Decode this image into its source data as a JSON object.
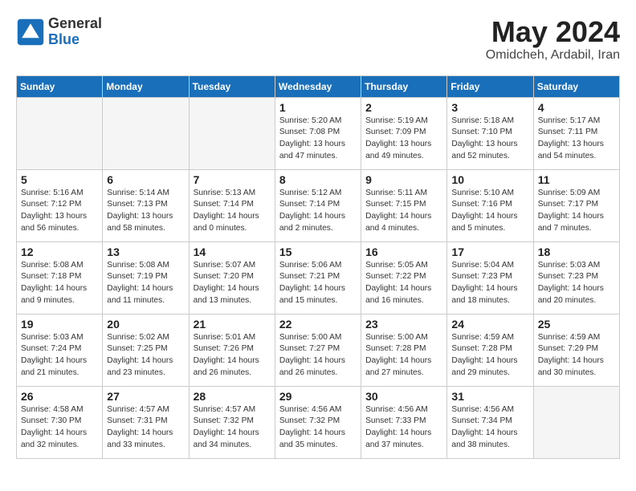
{
  "header": {
    "logo_general": "General",
    "logo_blue": "Blue",
    "month": "May 2024",
    "location": "Omidcheh, Ardabil, Iran"
  },
  "weekdays": [
    "Sunday",
    "Monday",
    "Tuesday",
    "Wednesday",
    "Thursday",
    "Friday",
    "Saturday"
  ],
  "weeks": [
    [
      {
        "day": "",
        "info": ""
      },
      {
        "day": "",
        "info": ""
      },
      {
        "day": "",
        "info": ""
      },
      {
        "day": "1",
        "info": "Sunrise: 5:20 AM\nSunset: 7:08 PM\nDaylight: 13 hours\nand 47 minutes."
      },
      {
        "day": "2",
        "info": "Sunrise: 5:19 AM\nSunset: 7:09 PM\nDaylight: 13 hours\nand 49 minutes."
      },
      {
        "day": "3",
        "info": "Sunrise: 5:18 AM\nSunset: 7:10 PM\nDaylight: 13 hours\nand 52 minutes."
      },
      {
        "day": "4",
        "info": "Sunrise: 5:17 AM\nSunset: 7:11 PM\nDaylight: 13 hours\nand 54 minutes."
      }
    ],
    [
      {
        "day": "5",
        "info": "Sunrise: 5:16 AM\nSunset: 7:12 PM\nDaylight: 13 hours\nand 56 minutes."
      },
      {
        "day": "6",
        "info": "Sunrise: 5:14 AM\nSunset: 7:13 PM\nDaylight: 13 hours\nand 58 minutes."
      },
      {
        "day": "7",
        "info": "Sunrise: 5:13 AM\nSunset: 7:14 PM\nDaylight: 14 hours\nand 0 minutes."
      },
      {
        "day": "8",
        "info": "Sunrise: 5:12 AM\nSunset: 7:14 PM\nDaylight: 14 hours\nand 2 minutes."
      },
      {
        "day": "9",
        "info": "Sunrise: 5:11 AM\nSunset: 7:15 PM\nDaylight: 14 hours\nand 4 minutes."
      },
      {
        "day": "10",
        "info": "Sunrise: 5:10 AM\nSunset: 7:16 PM\nDaylight: 14 hours\nand 5 minutes."
      },
      {
        "day": "11",
        "info": "Sunrise: 5:09 AM\nSunset: 7:17 PM\nDaylight: 14 hours\nand 7 minutes."
      }
    ],
    [
      {
        "day": "12",
        "info": "Sunrise: 5:08 AM\nSunset: 7:18 PM\nDaylight: 14 hours\nand 9 minutes."
      },
      {
        "day": "13",
        "info": "Sunrise: 5:08 AM\nSunset: 7:19 PM\nDaylight: 14 hours\nand 11 minutes."
      },
      {
        "day": "14",
        "info": "Sunrise: 5:07 AM\nSunset: 7:20 PM\nDaylight: 14 hours\nand 13 minutes."
      },
      {
        "day": "15",
        "info": "Sunrise: 5:06 AM\nSunset: 7:21 PM\nDaylight: 14 hours\nand 15 minutes."
      },
      {
        "day": "16",
        "info": "Sunrise: 5:05 AM\nSunset: 7:22 PM\nDaylight: 14 hours\nand 16 minutes."
      },
      {
        "day": "17",
        "info": "Sunrise: 5:04 AM\nSunset: 7:23 PM\nDaylight: 14 hours\nand 18 minutes."
      },
      {
        "day": "18",
        "info": "Sunrise: 5:03 AM\nSunset: 7:23 PM\nDaylight: 14 hours\nand 20 minutes."
      }
    ],
    [
      {
        "day": "19",
        "info": "Sunrise: 5:03 AM\nSunset: 7:24 PM\nDaylight: 14 hours\nand 21 minutes."
      },
      {
        "day": "20",
        "info": "Sunrise: 5:02 AM\nSunset: 7:25 PM\nDaylight: 14 hours\nand 23 minutes."
      },
      {
        "day": "21",
        "info": "Sunrise: 5:01 AM\nSunset: 7:26 PM\nDaylight: 14 hours\nand 26 minutes."
      },
      {
        "day": "22",
        "info": "Sunrise: 5:00 AM\nSunset: 7:27 PM\nDaylight: 14 hours\nand 26 minutes."
      },
      {
        "day": "23",
        "info": "Sunrise: 5:00 AM\nSunset: 7:28 PM\nDaylight: 14 hours\nand 27 minutes."
      },
      {
        "day": "24",
        "info": "Sunrise: 4:59 AM\nSunset: 7:28 PM\nDaylight: 14 hours\nand 29 minutes."
      },
      {
        "day": "25",
        "info": "Sunrise: 4:59 AM\nSunset: 7:29 PM\nDaylight: 14 hours\nand 30 minutes."
      }
    ],
    [
      {
        "day": "26",
        "info": "Sunrise: 4:58 AM\nSunset: 7:30 PM\nDaylight: 14 hours\nand 32 minutes."
      },
      {
        "day": "27",
        "info": "Sunrise: 4:57 AM\nSunset: 7:31 PM\nDaylight: 14 hours\nand 33 minutes."
      },
      {
        "day": "28",
        "info": "Sunrise: 4:57 AM\nSunset: 7:32 PM\nDaylight: 14 hours\nand 34 minutes."
      },
      {
        "day": "29",
        "info": "Sunrise: 4:56 AM\nSunset: 7:32 PM\nDaylight: 14 hours\nand 35 minutes."
      },
      {
        "day": "30",
        "info": "Sunrise: 4:56 AM\nSunset: 7:33 PM\nDaylight: 14 hours\nand 37 minutes."
      },
      {
        "day": "31",
        "info": "Sunrise: 4:56 AM\nSunset: 7:34 PM\nDaylight: 14 hours\nand 38 minutes."
      },
      {
        "day": "",
        "info": ""
      }
    ]
  ]
}
